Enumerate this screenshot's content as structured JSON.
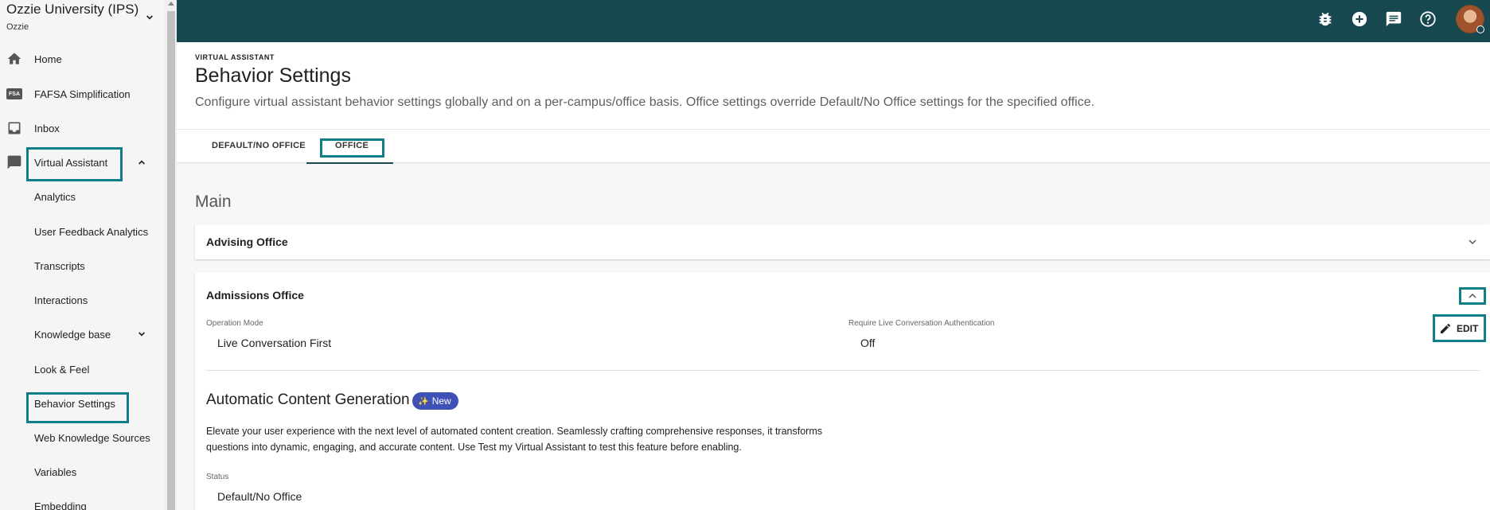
{
  "sidebar": {
    "org_name": "Ozzie University (IPS)",
    "org_sub": "Ozzie",
    "items": [
      {
        "label": "Home",
        "icon": "home-icon"
      },
      {
        "label": "FAFSA Simplification",
        "icon": "fafsa-icon"
      },
      {
        "label": "Inbox",
        "icon": "inbox-icon"
      },
      {
        "label": "Virtual Assistant",
        "icon": "chat-icon"
      },
      {
        "label": "Analytics"
      },
      {
        "label": "User Feedback Analytics"
      },
      {
        "label": "Transcripts"
      },
      {
        "label": "Interactions"
      },
      {
        "label": "Knowledge base"
      },
      {
        "label": "Look & Feel"
      },
      {
        "label": "Behavior Settings"
      },
      {
        "label": "Web Knowledge Sources"
      },
      {
        "label": "Variables"
      },
      {
        "label": "Embedding"
      }
    ],
    "fafsa_icon_text": "FSA"
  },
  "topbar": {
    "icons": [
      "bug-icon",
      "add-circle-icon",
      "message-icon",
      "help-icon"
    ]
  },
  "header": {
    "overline": "VIRTUAL ASSISTANT",
    "title": "Behavior Settings",
    "description": "Configure virtual assistant behavior settings globally and on a per-campus/office basis. Office settings override Default/No Office settings for the specified office."
  },
  "tabs": [
    {
      "label": "DEFAULT/NO OFFICE"
    },
    {
      "label": "OFFICE",
      "selected": true
    }
  ],
  "main": {
    "section_title": "Main",
    "advising_office": {
      "title": "Advising Office"
    },
    "admissions_office": {
      "title": "Admissions Office",
      "operation_mode_label": "Operation Mode",
      "operation_mode_value": "Live Conversation First",
      "auth_label": "Require Live Conversation Authentication",
      "auth_value": "Off",
      "edit_label": "EDIT",
      "acg_title": "Automatic Content Generation",
      "acg_badge": "New",
      "acg_desc_line1": "Elevate your user experience with the next level of automated content creation. Seamlessly crafting comprehensive responses, it transforms",
      "acg_desc_line2": "questions into dynamic, engaging, and accurate content. Use Test my Virtual Assistant to test this feature before enabling.",
      "status_label": "Status",
      "status_value": "Default/No Office"
    }
  },
  "colors": {
    "topbar": "#17474f",
    "highlight": "#0e7f86",
    "badge": "#3f51b5"
  }
}
